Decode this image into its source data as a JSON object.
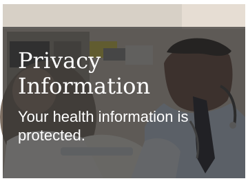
{
  "card": {
    "title": "Privacy\nInformation",
    "subtitle": "Your health information is protected."
  },
  "image": {
    "icon": "doctor-with-patient-photo"
  },
  "colors": {
    "overlay": "#232323",
    "text": "#ffffff",
    "background": "#ffffff"
  }
}
